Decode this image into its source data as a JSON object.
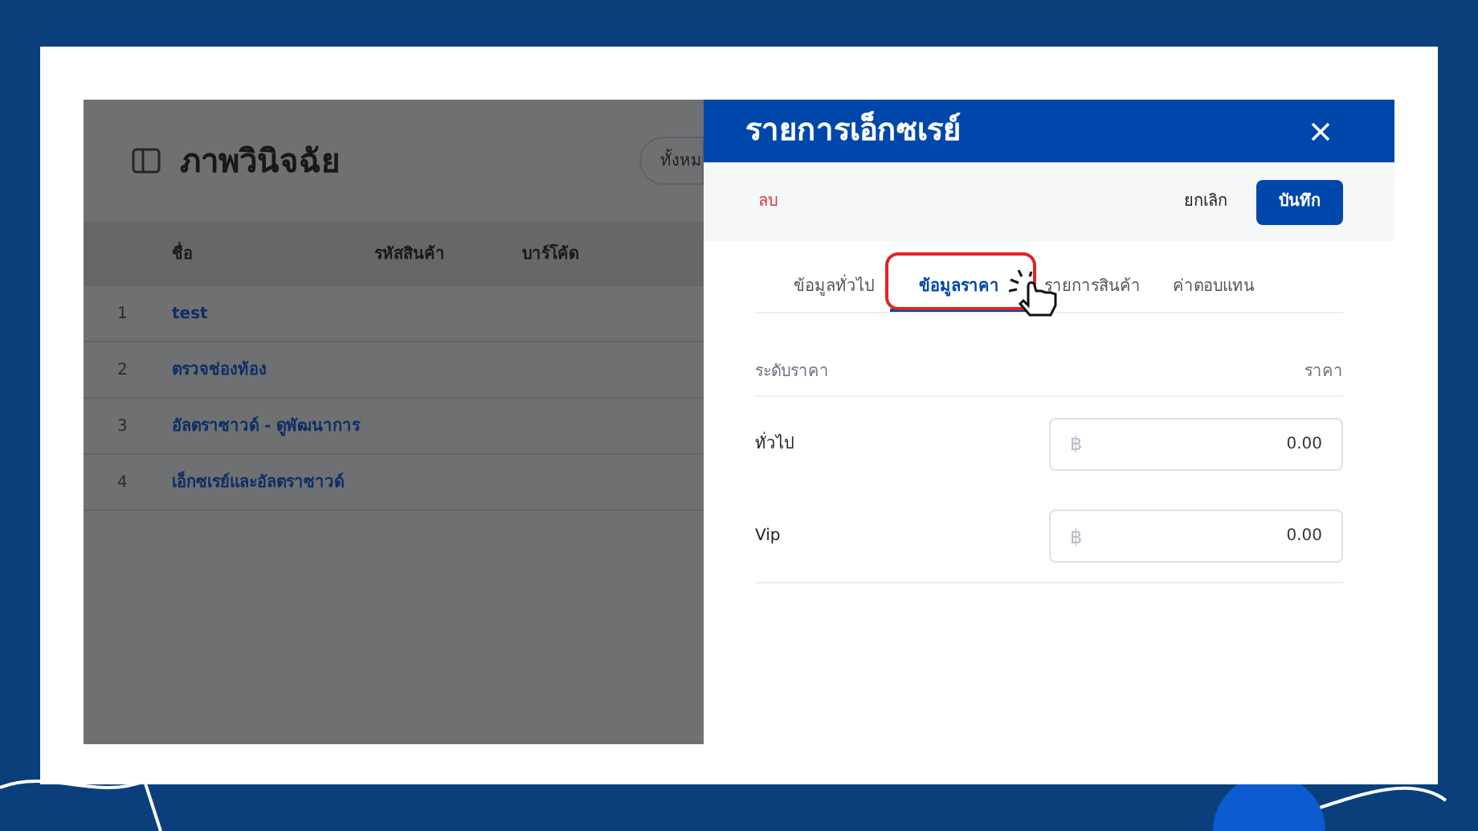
{
  "page": {
    "title": "ภาพวินิจฉัย",
    "filter_button": "ทั้งหม",
    "table": {
      "columns": [
        "ชื่อ",
        "รหัสสินค้า",
        "บาร์โค้ด"
      ],
      "rows": [
        {
          "index": "1",
          "name": "test"
        },
        {
          "index": "2",
          "name": "ตรวจช่องท้อง"
        },
        {
          "index": "3",
          "name": "อัลตราซาวด์ - ดูพัฒนาการ"
        },
        {
          "index": "4",
          "name": "เอ็กซเรย์และอัลตราซาวด์"
        }
      ]
    }
  },
  "panel": {
    "title": "รายการเอ็กซเรย์",
    "delete": "ลบ",
    "cancel": "ยกเลิก",
    "save": "บันทึก",
    "tabs": [
      {
        "label": "ข้อมูลทั่วไป",
        "selected": false
      },
      {
        "label": "ข้อมูลราคา",
        "selected": true
      },
      {
        "label": "รายการสินค้า",
        "selected": false
      },
      {
        "label": "ค่าตอบแทน",
        "selected": false
      }
    ],
    "price_table": {
      "columns": [
        "ระดับราคา",
        "ราคา"
      ],
      "rows": [
        {
          "level_name": "ทั่วไป",
          "currency": "฿",
          "value": "0.00"
        },
        {
          "level_name": "Vip",
          "currency": "฿",
          "value": "0.00"
        }
      ]
    }
  }
}
